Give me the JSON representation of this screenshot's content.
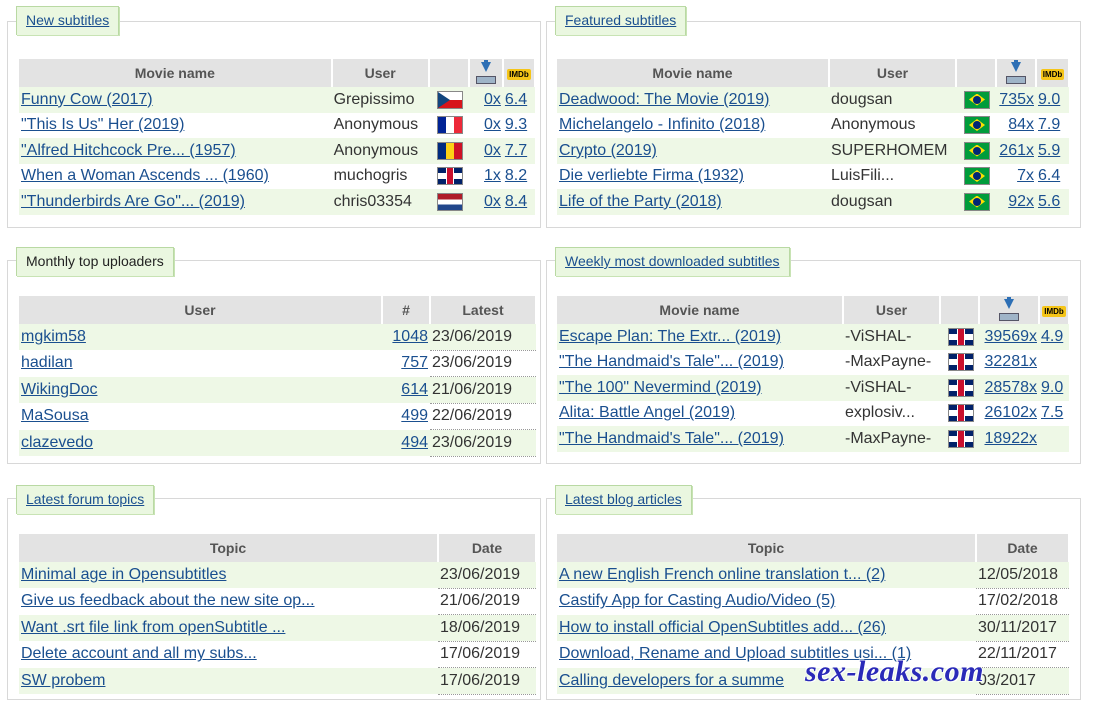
{
  "new_subtitles": {
    "title": "New subtitles",
    "headers": {
      "movie": "Movie name",
      "user": "User"
    },
    "rows": [
      {
        "movie": "Funny Cow (2017)",
        "user": "Grepissimo",
        "flag": "cz",
        "downloads": "0x",
        "rating": "6.4"
      },
      {
        "movie": "\"This Is Us\" Her (2019)",
        "user": "Anonymous",
        "flag": "fr",
        "downloads": "0x",
        "rating": "9.3"
      },
      {
        "movie": "\"Alfred Hitchcock Pre... (1957)",
        "user": "Anonymous",
        "flag": "ro",
        "downloads": "0x",
        "rating": "7.7"
      },
      {
        "movie": "When a Woman Ascends ... (1960)",
        "user": "muchogris",
        "flag": "uk",
        "downloads": "1x",
        "rating": "8.2"
      },
      {
        "movie": "\"Thunderbirds Are Go\"... (2019)",
        "user": "chris03354",
        "flag": "nl",
        "downloads": "0x",
        "rating": "8.4"
      }
    ]
  },
  "featured_subtitles": {
    "title": "Featured subtitles",
    "headers": {
      "movie": "Movie name",
      "user": "User"
    },
    "rows": [
      {
        "movie": "Deadwood: The Movie (2019)",
        "user": "dougsan",
        "flag": "br",
        "downloads": "735x",
        "rating": "9.0"
      },
      {
        "movie": "Michelangelo - Infinito (2018)",
        "user": "Anonymous",
        "flag": "br",
        "downloads": "84x",
        "rating": "7.9"
      },
      {
        "movie": "Crypto (2019)",
        "user": "SUPERHOMEM",
        "flag": "br",
        "downloads": "261x",
        "rating": "5.9"
      },
      {
        "movie": "Die verliebte Firma (1932)",
        "user": "LuisFili...",
        "flag": "br",
        "downloads": "7x",
        "rating": "6.4"
      },
      {
        "movie": "Life of the Party (2018)",
        "user": "dougsan",
        "flag": "br",
        "downloads": "92x",
        "rating": "5.6"
      }
    ]
  },
  "top_uploaders": {
    "title": "Monthly top uploaders",
    "headers": {
      "user": "User",
      "count": "#",
      "latest": "Latest"
    },
    "rows": [
      {
        "user": "mgkim58",
        "count": "1048",
        "latest": "23/06/2019"
      },
      {
        "user": "hadilan",
        "count": "757",
        "latest": "23/06/2019"
      },
      {
        "user": "WikingDoc",
        "count": "614",
        "latest": "21/06/2019"
      },
      {
        "user": "MaSousa",
        "count": "499",
        "latest": "22/06/2019"
      },
      {
        "user": "clazevedo",
        "count": "494",
        "latest": "23/06/2019"
      }
    ]
  },
  "weekly_downloaded": {
    "title": "Weekly most downloaded subtitles",
    "headers": {
      "movie": "Movie name",
      "user": "User"
    },
    "rows": [
      {
        "movie": "Escape Plan: The Extr... (2019)",
        "user": "-ViSHAL-",
        "flag": "uk",
        "downloads": "39569x",
        "rating": "4.9"
      },
      {
        "movie": "\"The Handmaid's Tale\"... (2019)",
        "user": "-MaxPayne-",
        "flag": "uk",
        "downloads": "32281x",
        "rating": ""
      },
      {
        "movie": "\"The 100\" Nevermind (2019)",
        "user": "-ViSHAL-",
        "flag": "uk",
        "downloads": "28578x",
        "rating": "9.0"
      },
      {
        "movie": "Alita: Battle Angel (2019)",
        "user": "explosiv...",
        "flag": "uk",
        "downloads": "26102x",
        "rating": "7.5"
      },
      {
        "movie": "\"The Handmaid's Tale\"... (2019)",
        "user": "-MaxPayne-",
        "flag": "uk",
        "downloads": "18922x",
        "rating": ""
      }
    ]
  },
  "forum_topics": {
    "title": "Latest forum topics",
    "headers": {
      "topic": "Topic",
      "date": "Date"
    },
    "rows": [
      {
        "topic": "Minimal age in Opensubtitles",
        "date": "23/06/2019"
      },
      {
        "topic": "Give us feedback about the new site op...",
        "date": "21/06/2019"
      },
      {
        "topic": "Want .srt file link from openSubtitle ...",
        "date": "18/06/2019"
      },
      {
        "topic": "Delete account and all my subs...",
        "date": "17/06/2019"
      },
      {
        "topic": "SW probem",
        "date": "17/06/2019"
      }
    ]
  },
  "blog_articles": {
    "title": "Latest blog articles",
    "headers": {
      "topic": "Topic",
      "date": "Date"
    },
    "rows": [
      {
        "topic": "A new English French online translation t... (2)",
        "date": "12/05/2018"
      },
      {
        "topic": "Castify App for Casting Audio/Video (5)",
        "date": "17/02/2018"
      },
      {
        "topic": "How to install official OpenSubtitles add... (26)",
        "date": "30/11/2017"
      },
      {
        "topic": "Download, Rename and Upload subtitles usi... (1)",
        "date": "22/11/2017"
      },
      {
        "topic": "Calling developers for a summe",
        "date": "03/2017"
      }
    ]
  },
  "icons": {
    "download": "download-icon",
    "imdb": "imdb-icon",
    "imdb_text": "IMDb"
  },
  "watermark": "sex-leaks.com",
  "colors": {
    "link": "#1a4f8f",
    "row_alt": "#eef8e6",
    "header": "#e3e3e3",
    "title_bg": "#eaf7e0"
  }
}
